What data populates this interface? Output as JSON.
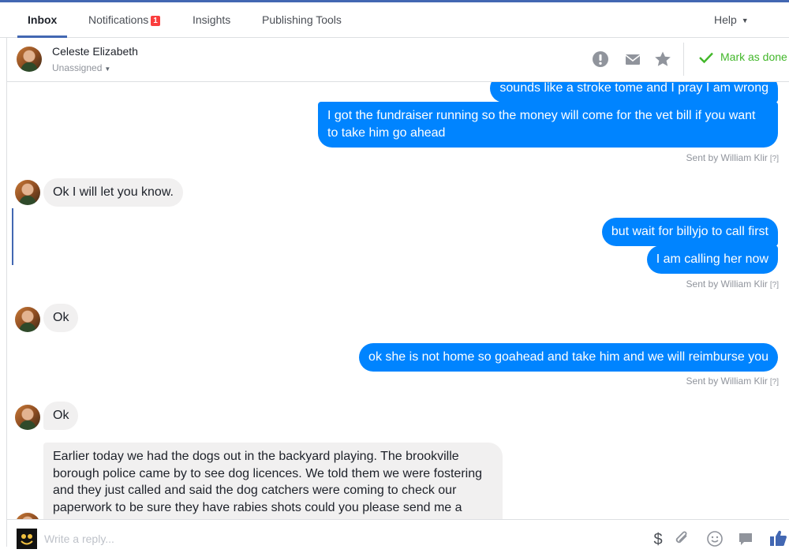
{
  "tabs": [
    {
      "label": "Inbox"
    },
    {
      "label": "Notifications",
      "badge": "1"
    },
    {
      "label": "Insights"
    },
    {
      "label": "Publishing Tools"
    }
  ],
  "help": {
    "label": "Help"
  },
  "header": {
    "contact_name": "Celeste Elizabeth",
    "assignee": "Unassigned",
    "mark_done_label": "Mark as done"
  },
  "messages": {
    "m1": "sounds like a stroke tome and I pray I am wrong",
    "m2_line1": "I got the fundraiser running so the money will come for the vet bill if you want",
    "m2_line2": "to take him go ahead",
    "m3": "Ok I will let you know.",
    "m4": "but wait for billyjo to call first",
    "m5": "I am calling her now",
    "m6": "Ok",
    "m7": "ok she is not home so goahead and take him and we will reimburse you",
    "m8": "Ok",
    "m9_lines": [
      "Earlier today we had the dogs out in the backyard playing. The brookville",
      "borough police came by to see dog licences. We told them we were fostering",
      "and they just called and said the dog catchers were coming to check our",
      "paperwork to be sure they have rabies shots could you please send me a"
    ]
  },
  "sent_by": "Sent by William Klir",
  "sent_by_help": "[?]",
  "composer": {
    "placeholder": "Write a reply..."
  },
  "colors": {
    "accent": "#4267b2",
    "outgoing": "#0084ff",
    "incoming": "#f1f0f0",
    "done": "#42b72a",
    "badge": "#fa3e3e"
  }
}
